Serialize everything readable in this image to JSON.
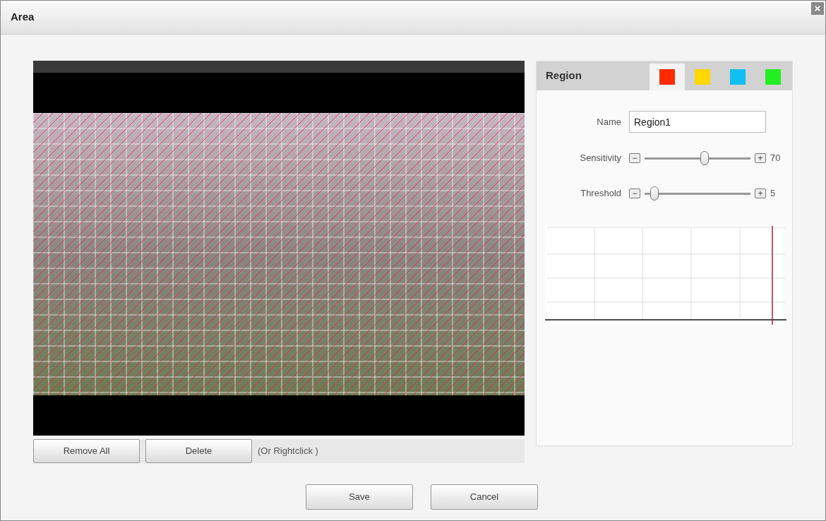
{
  "window": {
    "title": "Area",
    "close": "×"
  },
  "video": {
    "buttons": [
      "Remove All",
      "Delete"
    ],
    "hint": "(Or Rightclick )"
  },
  "region": {
    "title": "Region",
    "tabs": [
      {
        "color": "#ff2a00",
        "selected": true
      },
      {
        "color": "#ffd800",
        "selected": false
      },
      {
        "color": "#10c0f0",
        "selected": false
      },
      {
        "color": "#22ee22",
        "selected": false
      }
    ],
    "name_label": "Name",
    "name_value": "Region1",
    "sliders": [
      {
        "label": "Sensitivity",
        "minus": "−",
        "plus": "+",
        "level": 0.57,
        "reading": "70"
      },
      {
        "label": "Threshold",
        "minus": "−",
        "plus": "+",
        "level": 0.06,
        "reading": "5"
      }
    ]
  },
  "footer": {
    "buttons": [
      "Save",
      "Cancel"
    ]
  }
}
